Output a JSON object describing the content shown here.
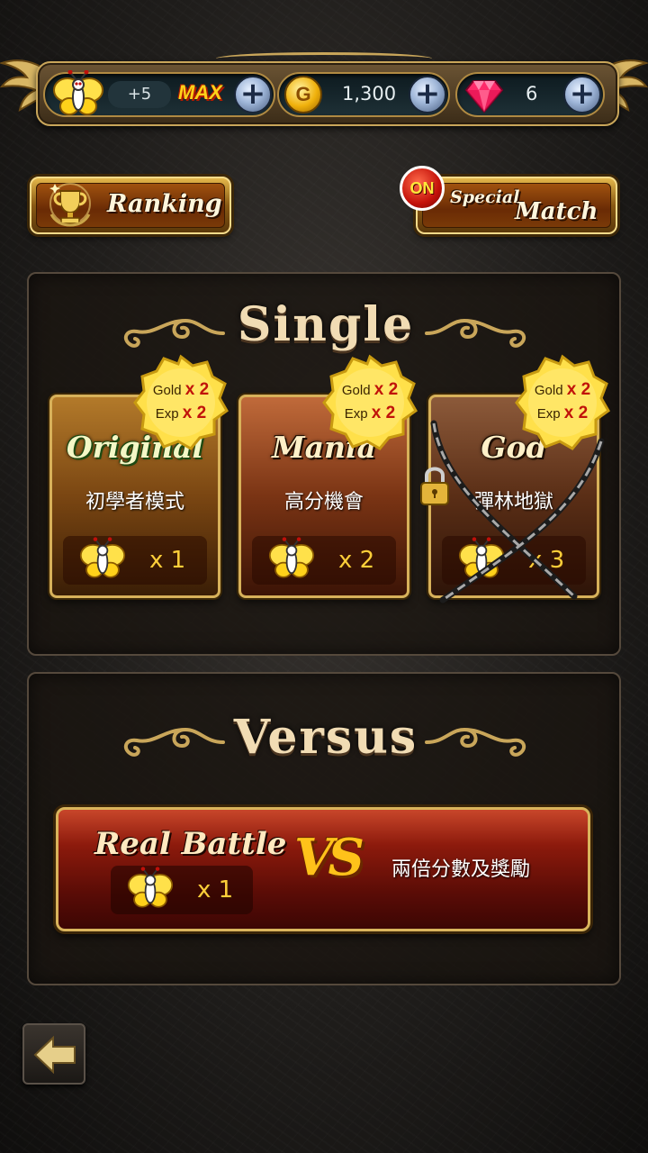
{
  "header": {
    "stamina": {
      "bonus": "+5",
      "status": "MAX"
    },
    "gold": {
      "icon_letter": "G",
      "amount": "1,300"
    },
    "gems": {
      "amount": "6"
    },
    "plus_symbol": "+"
  },
  "buttons": {
    "ranking_label": "Ranking",
    "special_match_line1": "Special",
    "special_match_line2": "Match",
    "special_status": "ON"
  },
  "single": {
    "title": "Single",
    "modes": [
      {
        "logo": "Original",
        "name": "初學者模式",
        "cost": "x 1",
        "bonus_gold": "Gold",
        "bonus_gold_mult": "x 2",
        "bonus_exp": "Exp",
        "bonus_exp_mult": "x 2",
        "locked": false
      },
      {
        "logo": "Mania",
        "name": "高分機會",
        "cost": "x 2",
        "bonus_gold": "Gold",
        "bonus_gold_mult": "x 2",
        "bonus_exp": "Exp",
        "bonus_exp_mult": "x 2",
        "locked": false
      },
      {
        "logo": "God",
        "name": "彈林地獄",
        "cost": "x 3",
        "bonus_gold": "Gold",
        "bonus_gold_mult": "x 2",
        "bonus_exp": "Exp",
        "bonus_exp_mult": "x 2",
        "locked": true
      }
    ]
  },
  "versus": {
    "title": "Versus",
    "real_battle": {
      "title": "Real Battle",
      "vs": "VS",
      "cost": "x 1",
      "description": "兩倍分數及獎勵"
    }
  },
  "colors": {
    "gold_trim": "#d7b15a",
    "accent_yellow": "#ffcf3a",
    "panel_bg": "#19140f"
  },
  "icons": [
    "butterfly-icon",
    "plus-icon",
    "gold-coin-icon",
    "gem-icon",
    "trophy-icon",
    "lock-icon",
    "chain-icon",
    "back-arrow-icon"
  ]
}
